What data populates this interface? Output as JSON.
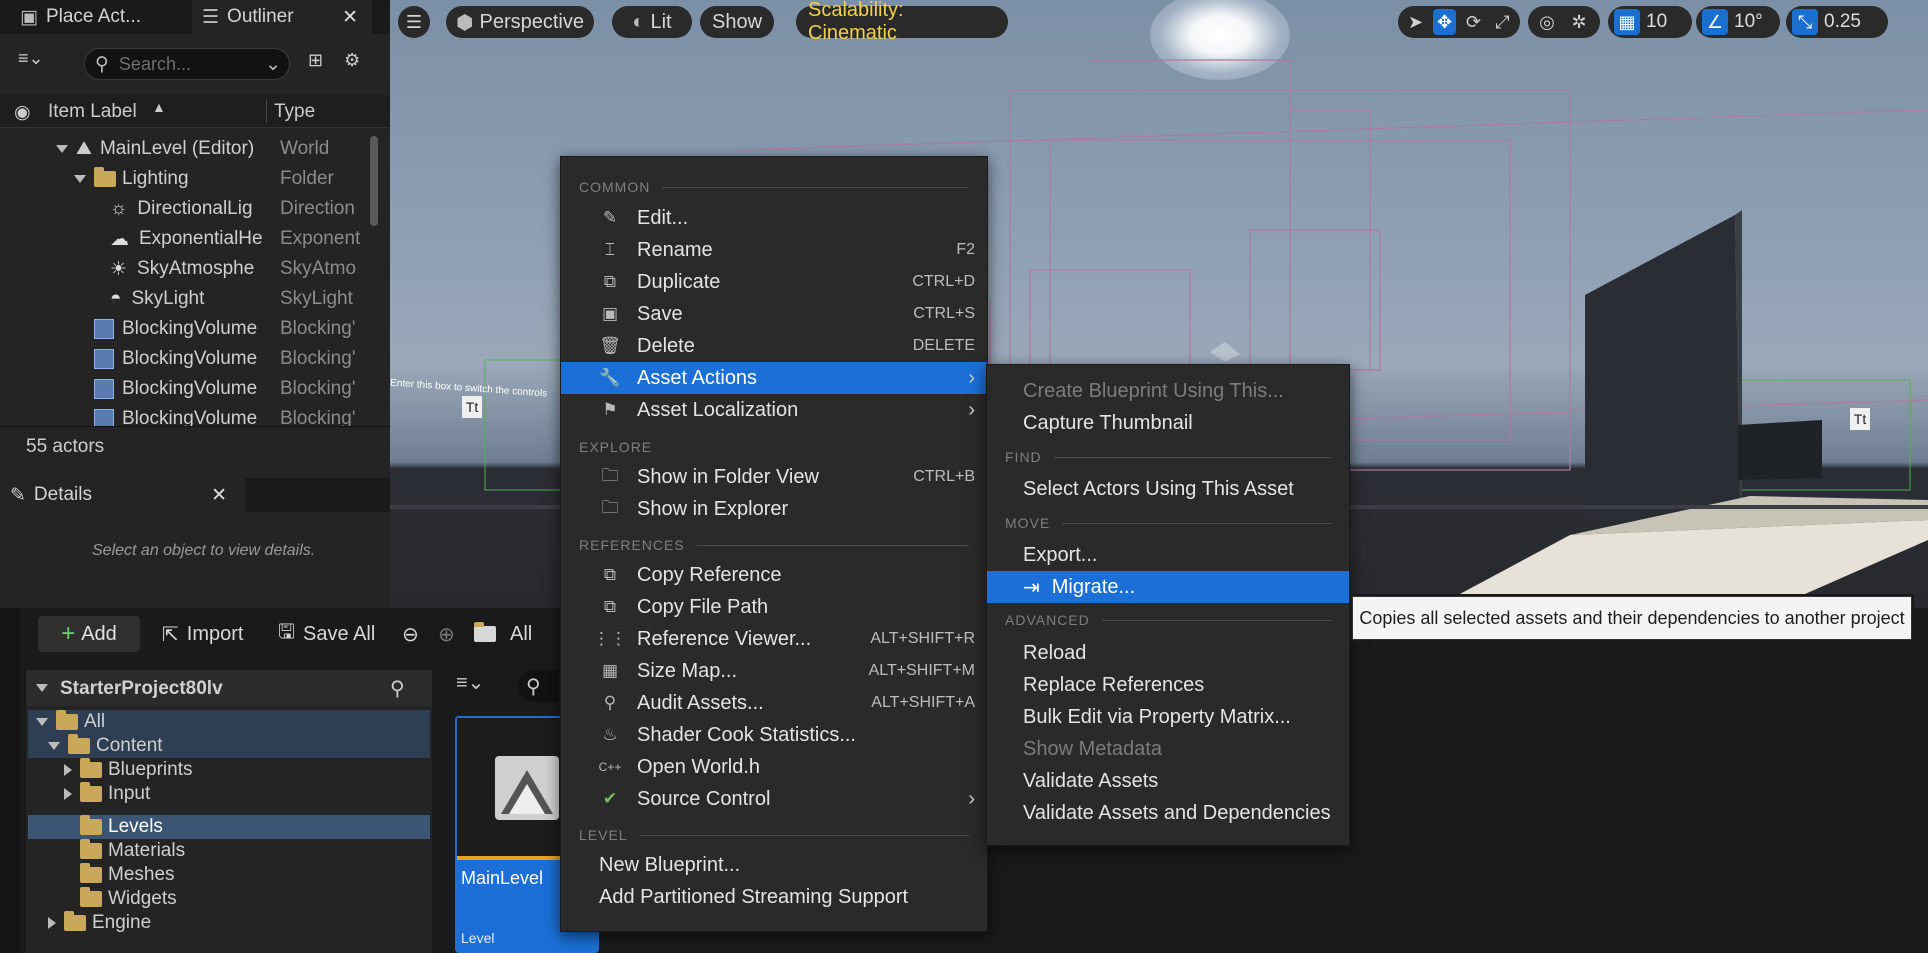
{
  "tabs": {
    "place_actors": "Place Act...",
    "outliner": "Outliner"
  },
  "outliner": {
    "search_placeholder": "Search...",
    "col_label": "Item Label",
    "col_type": "Type",
    "rows": [
      {
        "label": "MainLevel (Editor)",
        "type": "World"
      },
      {
        "label": "Lighting",
        "type": "Folder"
      },
      {
        "label": "DirectionalLig",
        "type": "Direction"
      },
      {
        "label": "ExponentialHe",
        "type": "Exponent"
      },
      {
        "label": "SkyAtmosphe",
        "type": "SkyAtmo"
      },
      {
        "label": "SkyLight",
        "type": "SkyLight"
      },
      {
        "label": "BlockingVolume",
        "type": "Blocking'"
      },
      {
        "label": "BlockingVolume",
        "type": "Blocking'"
      },
      {
        "label": "BlockingVolume",
        "type": "Blocking'"
      },
      {
        "label": "BlockingVolume",
        "type": "Blocking'"
      }
    ],
    "actor_count": "55 actors"
  },
  "details": {
    "tab": "Details",
    "empty": "Select an object to view details."
  },
  "viewport": {
    "perspective": "Perspective",
    "lit": "Lit",
    "show": "Show",
    "scalability": "Scalability: Cinematic",
    "grid_value": "10",
    "angle_value": "10°",
    "scale_value": "0.25"
  },
  "content_browser": {
    "add": "Add",
    "import": "Import",
    "save_all": "Save All",
    "path_all": "All",
    "project": "StarterProject80lv",
    "tree": [
      {
        "label": "All"
      },
      {
        "label": "Content"
      },
      {
        "label": "Blueprints"
      },
      {
        "label": "Input"
      },
      {
        "label": "Levels"
      },
      {
        "label": "Materials"
      },
      {
        "label": "Meshes"
      },
      {
        "label": "Widgets"
      },
      {
        "label": "Engine"
      }
    ],
    "asset_name": "MainLevel",
    "asset_type": "Level"
  },
  "context_menu": {
    "sections": {
      "common": "COMMON",
      "explore": "EXPLORE",
      "references": "REFERENCES",
      "level": "LEVEL"
    },
    "items": {
      "edit": "Edit...",
      "rename": "Rename",
      "rename_sc": "F2",
      "duplicate": "Duplicate",
      "duplicate_sc": "CTRL+D",
      "save": "Save",
      "save_sc": "CTRL+S",
      "delete": "Delete",
      "delete_sc": "DELETE",
      "asset_actions": "Asset Actions",
      "asset_localization": "Asset Localization",
      "show_folder": "Show in Folder View",
      "show_folder_sc": "CTRL+B",
      "show_explorer": "Show in Explorer",
      "copy_reference": "Copy Reference",
      "copy_file_path": "Copy File Path",
      "reference_viewer": "Reference Viewer...",
      "reference_viewer_sc": "ALT+SHIFT+R",
      "size_map": "Size Map...",
      "size_map_sc": "ALT+SHIFT+M",
      "audit_assets": "Audit Assets...",
      "audit_assets_sc": "ALT+SHIFT+A",
      "shader_cook": "Shader Cook Statistics...",
      "open_world": "Open World.h",
      "source_control": "Source Control",
      "new_blueprint": "New Blueprint...",
      "add_partitioned": "Add Partitioned Streaming Support"
    }
  },
  "submenu": {
    "sections": {
      "find": "FIND",
      "move": "MOVE",
      "advanced": "ADVANCED"
    },
    "items": {
      "create_blueprint": "Create Blueprint Using This...",
      "capture_thumbnail": "Capture Thumbnail",
      "select_actors": "Select Actors Using This Asset",
      "export": "Export...",
      "migrate": "Migrate...",
      "reload": "Reload",
      "replace_refs": "Replace References",
      "bulk_edit": "Bulk Edit via Property Matrix...",
      "show_metadata": "Show Metadata",
      "validate": "Validate Assets",
      "validate_deps": "Validate Assets and Dependencies"
    }
  },
  "tooltip": "Copies all selected assets and their dependencies to another project",
  "colors": {
    "highlight": "#1b6fd6",
    "scalability": "#f2d14a",
    "folder": "#c9a85a"
  }
}
